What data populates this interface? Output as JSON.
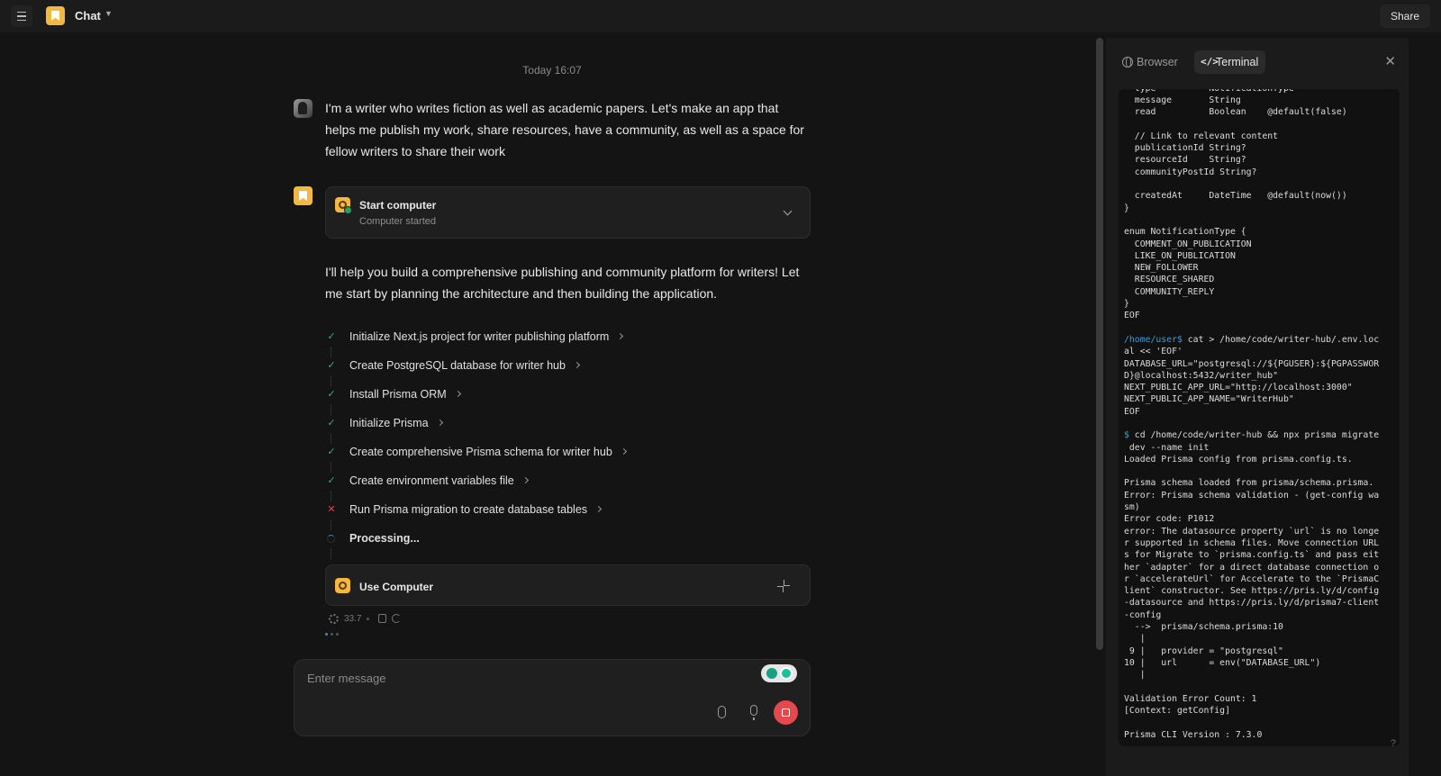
{
  "topbar": {
    "title": "Chat",
    "share_label": "Share"
  },
  "conversation": {
    "timestamp": "Today 16:07",
    "user_message": "I'm a writer who writes fiction as well as academic papers. Let's make an app that helps me publish my work, share resources, have a community, as well as a space for fellow writers to share their work",
    "start_computer": {
      "title": "Start computer",
      "subtitle": "Computer started"
    },
    "assistant_message": "I'll help you build a comprehensive publishing and community platform for writers! Let me start by planning the architecture and then building the application.",
    "steps": [
      {
        "label": "Initialize Next.js project for writer publishing platform",
        "status": "done"
      },
      {
        "label": "Create PostgreSQL database for writer hub",
        "status": "done"
      },
      {
        "label": "Install Prisma ORM",
        "status": "done"
      },
      {
        "label": "Initialize Prisma",
        "status": "done"
      },
      {
        "label": "Create comprehensive Prisma schema for writer hub",
        "status": "done"
      },
      {
        "label": "Create environment variables file",
        "status": "done"
      },
      {
        "label": "Run Prisma migration to create database tables",
        "status": "error"
      },
      {
        "label": "Processing...",
        "status": "loading"
      }
    ],
    "use_computer": {
      "title": "Use Computer"
    },
    "meta": {
      "credits": "33.7"
    }
  },
  "input": {
    "placeholder": "Enter message"
  },
  "side_panel": {
    "tabs": [
      {
        "label": "Browser",
        "active": false
      },
      {
        "label": "Terminal",
        "active": true
      }
    ],
    "terminal_lines": [
      {
        "t": "  type          NotificationType"
      },
      {
        "t": "  message       String"
      },
      {
        "t": "  read          Boolean    @default(false)"
      },
      {
        "t": ""
      },
      {
        "t": "  // Link to relevant content"
      },
      {
        "t": "  publicationId String?"
      },
      {
        "t": "  resourceId    String?"
      },
      {
        "t": "  communityPostId String?"
      },
      {
        "t": ""
      },
      {
        "t": "  createdAt     DateTime   @default(now())"
      },
      {
        "t": "}"
      },
      {
        "t": ""
      },
      {
        "t": "enum NotificationType {"
      },
      {
        "t": "  COMMENT_ON_PUBLICATION"
      },
      {
        "t": "  LIKE_ON_PUBLICATION"
      },
      {
        "t": "  NEW_FOLLOWER"
      },
      {
        "t": "  RESOURCE_SHARED"
      },
      {
        "t": "  COMMUNITY_REPLY"
      },
      {
        "t": "}"
      },
      {
        "t": "EOF"
      },
      {
        "t": ""
      },
      {
        "p": "/home/user$",
        "t": " cat > /home/code/writer-hub/.env.loc"
      },
      {
        "t": "al << 'EOF'"
      },
      {
        "t": "DATABASE_URL=\"postgresql://${PGUSER}:${PGPASSWOR"
      },
      {
        "t": "D}@localhost:5432/writer_hub\""
      },
      {
        "t": "NEXT_PUBLIC_APP_URL=\"http://localhost:3000\""
      },
      {
        "t": "NEXT_PUBLIC_APP_NAME=\"WriterHub\""
      },
      {
        "t": "EOF"
      },
      {
        "t": ""
      },
      {
        "p": "$",
        "t": " cd /home/code/writer-hub && npx prisma migrate"
      },
      {
        "t": " dev --name init"
      },
      {
        "t": "Loaded Prisma config from prisma.config.ts."
      },
      {
        "t": ""
      },
      {
        "t": "Prisma schema loaded from prisma/schema.prisma."
      },
      {
        "t": "Error: Prisma schema validation - (get-config wa"
      },
      {
        "t": "sm)"
      },
      {
        "t": "Error code: P1012"
      },
      {
        "t": "error: The datasource property `url` is no longe"
      },
      {
        "t": "r supported in schema files. Move connection URL"
      },
      {
        "t": "s for Migrate to `prisma.config.ts` and pass eit"
      },
      {
        "t": "her `adapter` for a direct database connection o"
      },
      {
        "t": "r `accelerateUrl` for Accelerate to the `PrismaC"
      },
      {
        "t": "lient` constructor. See https://pris.ly/d/config"
      },
      {
        "t": "-datasource and https://pris.ly/d/prisma7-client"
      },
      {
        "t": "-config"
      },
      {
        "t": "  -->  prisma/schema.prisma:10"
      },
      {
        "t": "   |"
      },
      {
        "t": " 9 |   provider = \"postgresql\""
      },
      {
        "t": "10 |   url      = env(\"DATABASE_URL\")"
      },
      {
        "t": "   |"
      },
      {
        "t": ""
      },
      {
        "t": "Validation Error Count: 1"
      },
      {
        "t": "[Context: getConfig]"
      },
      {
        "t": ""
      },
      {
        "t": "Prisma CLI Version : 7.3.0"
      }
    ]
  },
  "colors": {
    "accent": "#f4b740",
    "success": "#2fb36a",
    "error": "#e0453e",
    "stop": "#e5484d",
    "prompt": "#3aa0d8"
  }
}
